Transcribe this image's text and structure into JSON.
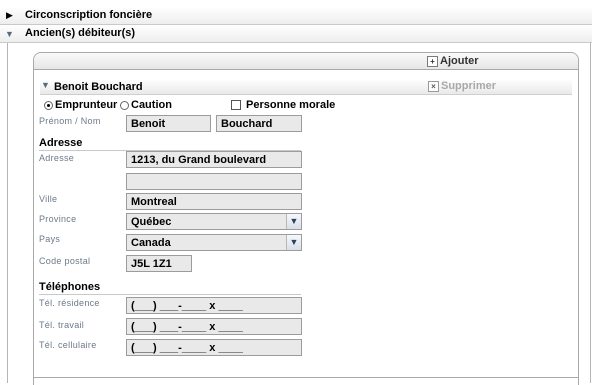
{
  "sections": {
    "circonscription": "Circonscription foncière",
    "anciens_debiteurs": "Ancien(s) débiteur(s)"
  },
  "toolbar": {
    "add_label": "Ajouter"
  },
  "debtor": {
    "name": "Benoit Bouchard",
    "delete_label": "Supprimer",
    "role_borrower": "Emprunteur",
    "role_guarantor": "Caution",
    "legal_entity": "Personne morale",
    "name_label": "Prénom / Nom",
    "first_name": "Benoit",
    "last_name": "Bouchard"
  },
  "address": {
    "heading": "Adresse",
    "address_label": "Adresse",
    "address_line1": "1213, du Grand boulevard",
    "address_line2": "",
    "city_label": "Ville",
    "city": "Montreal",
    "province_label": "Province",
    "province": "Québec",
    "country_label": "Pays",
    "country": "Canada",
    "postal_label": "Code postal",
    "postal_code": "J5L 1Z1"
  },
  "phones": {
    "heading": "Téléphones",
    "home_label": "Tél. résidence",
    "home": "(___) ___-____ x ____",
    "work_label": "Tél. travail",
    "work": "(___) ___-____ x ____",
    "cell_label": "Tél. cellulaire",
    "cell": "(___) ___-____ x ____"
  },
  "icons": {
    "collapsed": "triangle-right-icon",
    "expanded": "triangle-down-icon",
    "add": "add-icon",
    "delete": "delete-icon",
    "dropdown": "chevron-down-icon"
  }
}
